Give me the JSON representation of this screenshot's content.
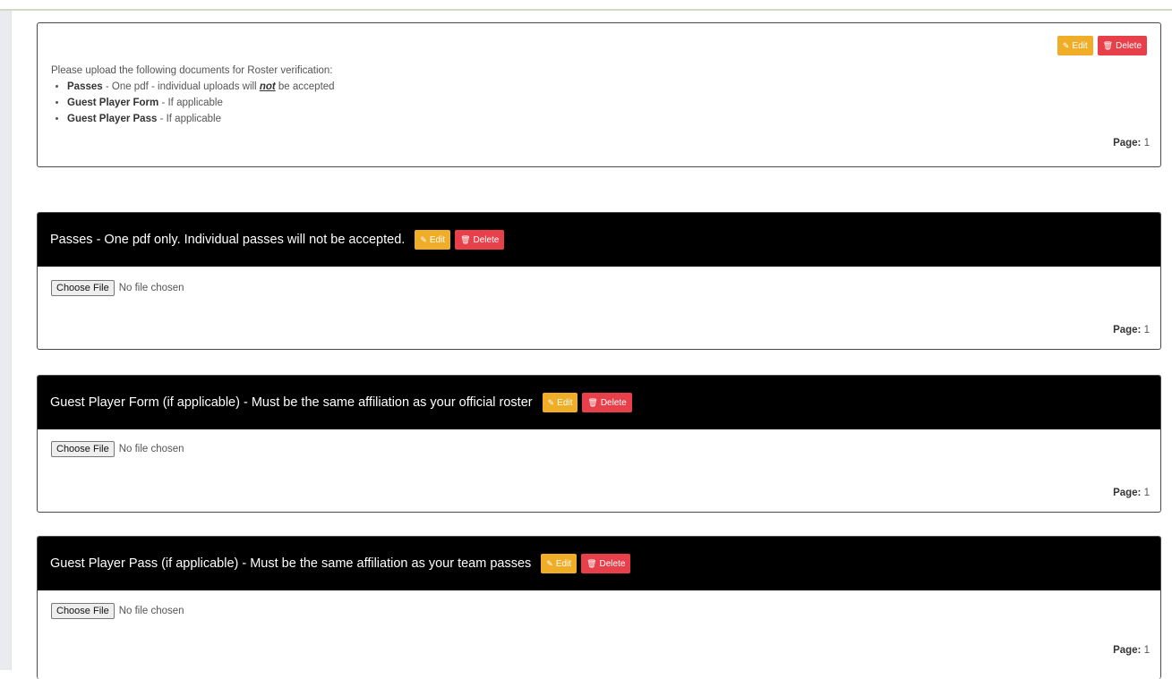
{
  "intro": {
    "edit_label": "Edit",
    "delete_label": "Delete",
    "heading": "Please upload the following documents for Roster verification:",
    "items": [
      {
        "strong": "Passes",
        "rest_before": " - One pdf - individual uploads will ",
        "emph": "not",
        "rest_after": " be accepted"
      },
      {
        "strong": "Guest Player Form",
        "rest_before": " - If applicable",
        "emph": "",
        "rest_after": ""
      },
      {
        "strong": "Guest Player Pass",
        "rest_before": " - If applicable",
        "emph": "",
        "rest_after": ""
      }
    ],
    "page_label": "Page:",
    "page_value": "1"
  },
  "uploads": [
    {
      "title": "Passes - One pdf only. Individual passes will not be accepted.",
      "edit_label": "Edit",
      "delete_label": "Delete",
      "choose_label": "Choose File",
      "file_status": "No file chosen",
      "page_label": "Page:",
      "page_value": "1"
    },
    {
      "title": "Guest Player Form (if applicable) - Must be the same affiliation as your official roster",
      "edit_label": "Edit",
      "delete_label": "Delete",
      "choose_label": "Choose File",
      "file_status": "No file chosen",
      "page_label": "Page:",
      "page_value": "1"
    },
    {
      "title": "Guest Player Pass (if applicable) - Must be the same affiliation as your team passes",
      "edit_label": "Edit",
      "delete_label": "Delete",
      "choose_label": "Choose File",
      "file_status": "No file chosen",
      "page_label": "Page:",
      "page_value": "1"
    }
  ],
  "icons": {
    "edit": "pencil-icon",
    "delete": "trash-icon"
  },
  "colors": {
    "edit": "#f0ad28",
    "delete": "#e8404a",
    "header": "#000000"
  }
}
